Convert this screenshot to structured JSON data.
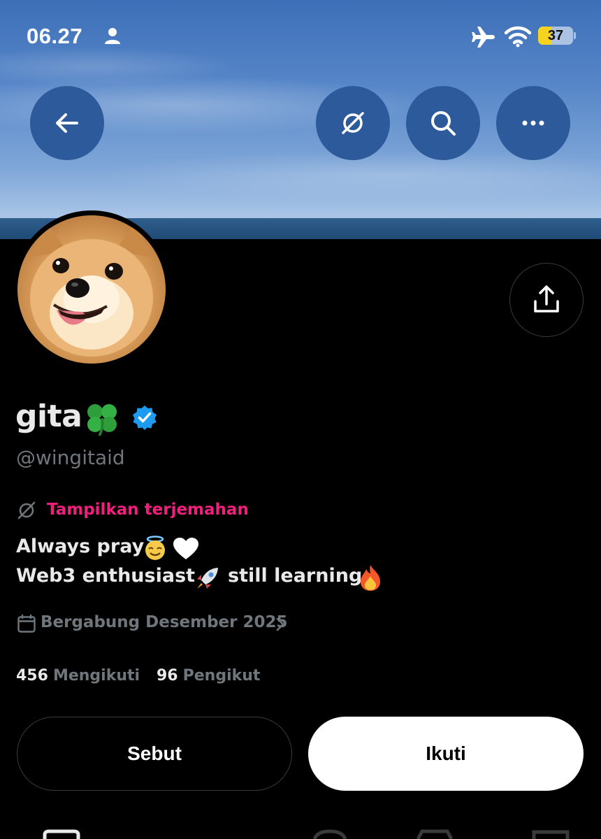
{
  "status_bar": {
    "time": "06.27",
    "battery_level": "37",
    "battery_fraction": 0.37,
    "icons": [
      "person-icon",
      "airplane-icon",
      "wifi-icon",
      "battery-icon"
    ]
  },
  "nav": {
    "buttons": [
      "back-arrow-icon",
      "translate-icon",
      "search-icon",
      "more-icon"
    ]
  },
  "profile": {
    "display_name": "gita",
    "name_emoji": "four-leaf-clover-icon",
    "verified": true,
    "handle": "@wingitaid",
    "translate_link": "Tampilkan terjemahan",
    "bio_line_1": "Always pray",
    "bio_line_2_a": "Web3 enthusiast",
    "bio_line_2_b": "still learning",
    "joined": "Bergabung Desember 2025",
    "following_count": "456",
    "following_label": "Mengikuti",
    "followers_count": "96",
    "followers_label": "Pengikut"
  },
  "actions": {
    "mention_label": "Sebut",
    "follow_label": "Ikuti"
  },
  "colors": {
    "accent_pink": "#f01f7e",
    "verified_blue": "#1d9bf0",
    "muted_text": "#6f767c",
    "nav_button": "#2d5a9a"
  }
}
